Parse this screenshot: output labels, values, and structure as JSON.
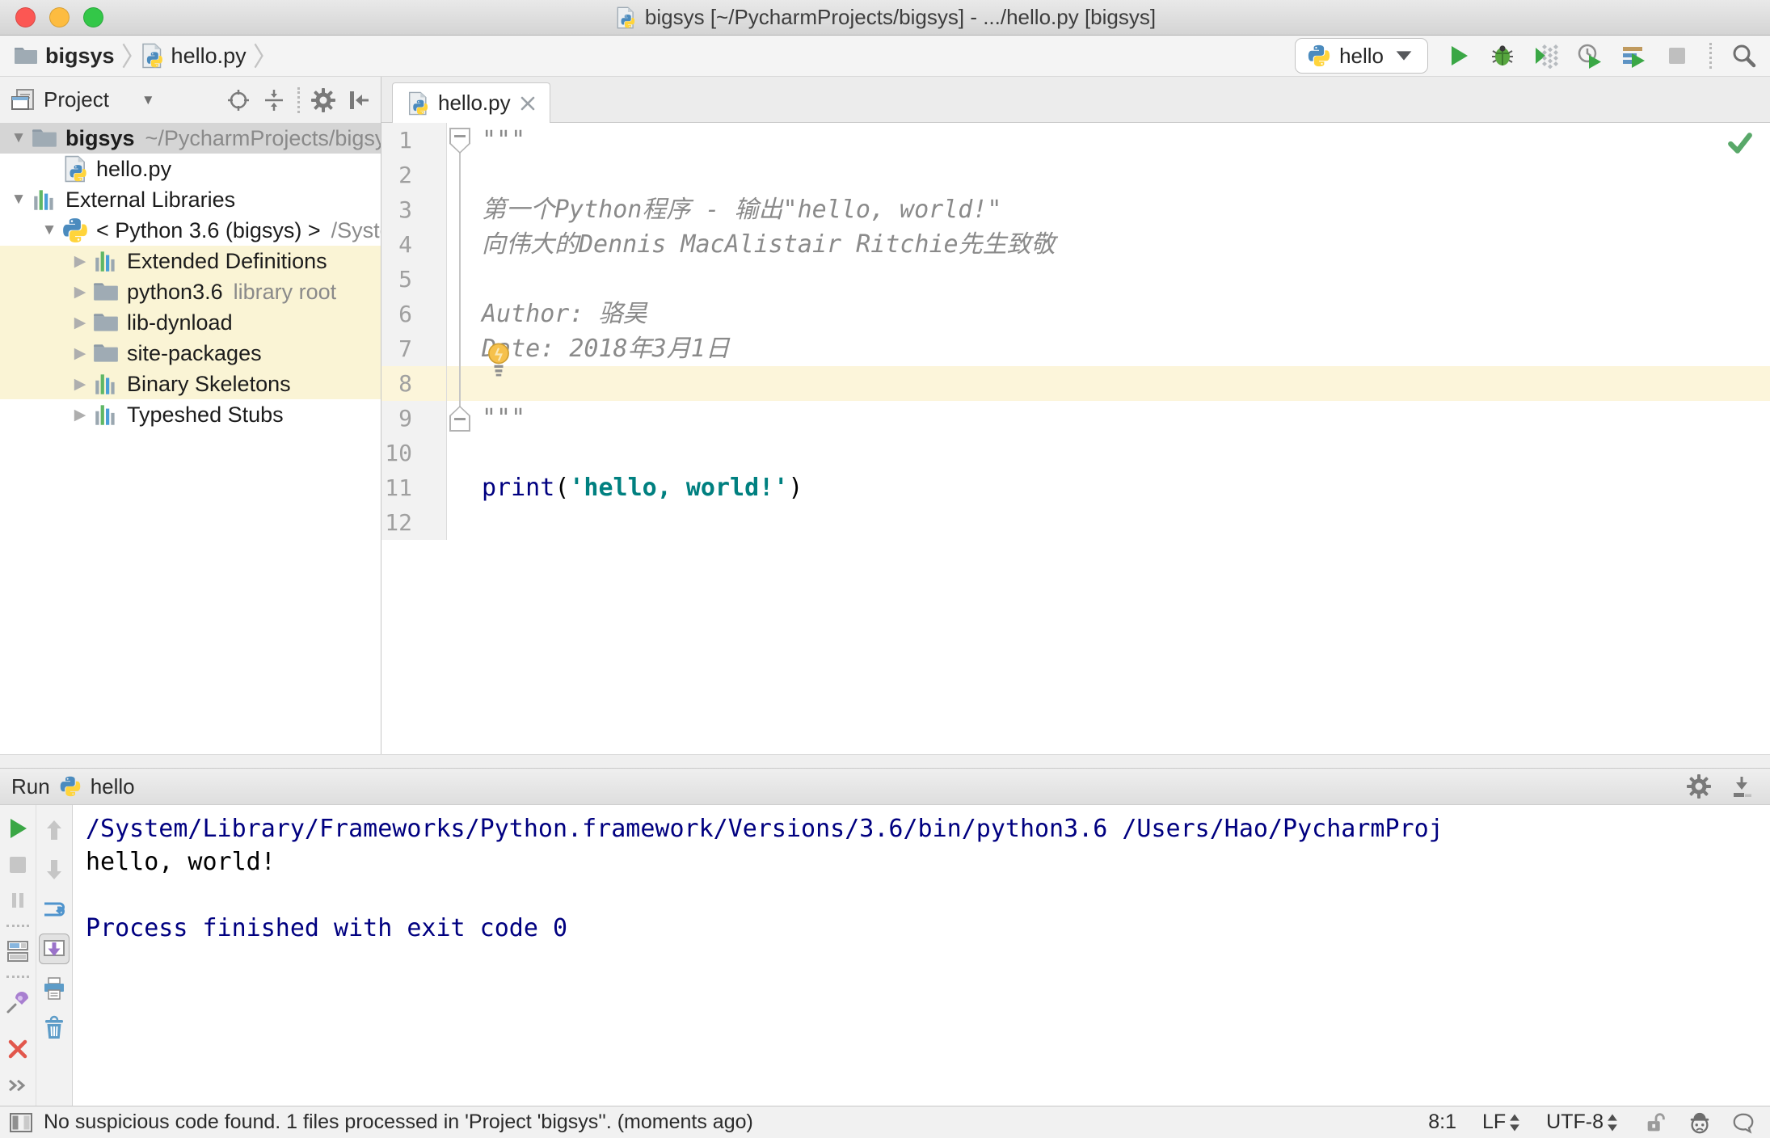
{
  "colors": {
    "comment": "#8a8a8a",
    "keyword": "#000080",
    "string": "#008080",
    "plain": "#000000",
    "console_system": "#000080",
    "console_stdout": "#000000",
    "tree_highlight": "#faf4d5",
    "current_line": "#fcf5da",
    "selection_gray": "#d5d5d5",
    "run_green": "#3aa745",
    "check_green": "#59a869"
  },
  "title_bar": {
    "title": "bigsys [~/PycharmProjects/bigsys] - .../hello.py [bigsys]"
  },
  "nav_bar": {
    "breadcrumbs": [
      {
        "label": "bigsys",
        "icon": "folder",
        "bold": true
      },
      {
        "label": "hello.py",
        "icon": "pyfile",
        "bold": false
      }
    ],
    "run_config": {
      "label": "hello",
      "icon": "python"
    },
    "buttons": [
      {
        "name": "run",
        "icon": "play"
      },
      {
        "name": "debug",
        "icon": "bug"
      },
      {
        "name": "run-with-coverage",
        "icon": "coverage"
      },
      {
        "name": "profiler",
        "icon": "profiler"
      },
      {
        "name": "concurrency-diagram",
        "icon": "concurrency"
      },
      {
        "name": "stop",
        "icon": "stop"
      },
      {
        "name": "separator"
      },
      {
        "name": "search-everywhere",
        "icon": "search"
      }
    ]
  },
  "project_panel": {
    "title": "Project",
    "header_icons": [
      {
        "name": "locate",
        "icon": "target"
      },
      {
        "name": "collapse-all",
        "icon": "collapse"
      },
      {
        "name": "separator"
      },
      {
        "name": "settings",
        "icon": "gear"
      },
      {
        "name": "hide-panel",
        "icon": "hideside"
      }
    ],
    "tree": [
      {
        "label": "bigsys",
        "hint": "~/PycharmProjects/bigsys",
        "icon": "folder",
        "arrow": "expanded",
        "indent": 0,
        "selected": true,
        "bold": true
      },
      {
        "label": "hello.py",
        "icon": "pyfile",
        "arrow": "none",
        "indent": 1
      },
      {
        "label": "External Libraries",
        "icon": "library",
        "arrow": "expanded",
        "indent": 0
      },
      {
        "label": "< Python 3.6 (bigsys) >",
        "hint": "/System",
        "icon": "python",
        "arrow": "expanded",
        "indent": 1
      },
      {
        "label": "Extended Definitions",
        "icon": "library",
        "arrow": "collapsed",
        "indent": 2,
        "highlighted": true
      },
      {
        "label": "python3.6",
        "hint": "library root",
        "icon": "folder",
        "arrow": "collapsed",
        "indent": 2,
        "highlighted": true
      },
      {
        "label": "lib-dynload",
        "icon": "folder",
        "arrow": "collapsed",
        "indent": 2,
        "highlighted": true
      },
      {
        "label": "site-packages",
        "icon": "folder",
        "arrow": "collapsed",
        "indent": 2,
        "highlighted": true
      },
      {
        "label": "Binary Skeletons",
        "icon": "library",
        "arrow": "collapsed",
        "indent": 2,
        "highlighted": true
      },
      {
        "label": "Typeshed Stubs",
        "icon": "library",
        "arrow": "collapsed",
        "indent": 2,
        "highlighted": false
      }
    ]
  },
  "editor": {
    "tab": {
      "label": "hello.py",
      "icon": "pyfile"
    },
    "current_line": 8,
    "lines": [
      {
        "n": 1,
        "segments": [
          {
            "t": "\"\"\"",
            "c": "comment"
          }
        ]
      },
      {
        "n": 2,
        "segments": []
      },
      {
        "n": 3,
        "segments": [
          {
            "t": "第一个Python程序 - 输出\"hello, world!\"",
            "c": "comment"
          }
        ]
      },
      {
        "n": 4,
        "segments": [
          {
            "t": "向伟大的Dennis MacAlistair Ritchie先生致敬",
            "c": "comment"
          }
        ]
      },
      {
        "n": 5,
        "segments": []
      },
      {
        "n": 6,
        "segments": [
          {
            "t": "Author: 骆昊",
            "c": "comment"
          }
        ]
      },
      {
        "n": 7,
        "segments": [
          {
            "t": "Date: 2018年3月1日",
            "c": "comment"
          }
        ]
      },
      {
        "n": 8,
        "segments": []
      },
      {
        "n": 9,
        "segments": [
          {
            "t": "\"\"\"",
            "c": "comment"
          }
        ]
      },
      {
        "n": 10,
        "segments": []
      },
      {
        "n": 11,
        "segments": [
          {
            "t": "print",
            "c": "keyword"
          },
          {
            "t": "(",
            "c": "plain"
          },
          {
            "t": "'hello, world!'",
            "c": "string"
          },
          {
            "t": ")",
            "c": "plain"
          }
        ]
      },
      {
        "n": 12,
        "segments": []
      }
    ]
  },
  "run_panel": {
    "title": "Run",
    "config": {
      "label": "hello",
      "icon": "python"
    },
    "header_icons": [
      {
        "name": "settings",
        "icon": "gear"
      },
      {
        "name": "hide-panel",
        "icon": "hidedown"
      }
    ],
    "toolbar_left": [
      {
        "name": "rerun",
        "icon": "play"
      },
      {
        "name": "stop",
        "icon": "stopgray"
      },
      {
        "name": "pause-output",
        "icon": "pause"
      },
      {
        "name": "separator"
      },
      {
        "name": "restore-layout",
        "icon": "layout"
      },
      {
        "name": "separator"
      },
      {
        "name": "pin-tab",
        "icon": "pin"
      },
      {
        "name": "close",
        "icon": "closered",
        "pushx": true
      },
      {
        "name": "more-options",
        "icon": "more",
        "pushend": true
      }
    ],
    "toolbar_right": [
      {
        "name": "up-the-stack-trace",
        "icon": "up"
      },
      {
        "name": "down-the-stack-trace",
        "icon": "down"
      },
      {
        "name": "use-soft-wraps",
        "icon": "softwrap"
      },
      {
        "name": "scroll-to-the-end",
        "icon": "scrollend",
        "selected": true
      },
      {
        "name": "print",
        "icon": "printer"
      },
      {
        "name": "clear-all",
        "icon": "trash"
      }
    ],
    "console": [
      {
        "text": "/System/Library/Frameworks/Python.framework/Versions/3.6/bin/python3.6 /Users/Hao/PycharmProj",
        "type": "system"
      },
      {
        "text": "hello, world!",
        "type": "stdout"
      },
      {
        "text": "",
        "type": "stdout"
      },
      {
        "text": "Process finished with exit code 0",
        "type": "system"
      }
    ]
  },
  "status_bar": {
    "message": "No suspicious code found. 1 files processed in 'Project 'bigsys''. (moments ago)",
    "caret_position": "8:1",
    "line_separator": "LF",
    "encoding": "UTF-8",
    "icons": [
      {
        "name": "write-access-unlocked",
        "icon": "unlock"
      },
      {
        "name": "hector-inspections",
        "icon": "hector"
      },
      {
        "name": "feedback-bubble",
        "icon": "bubble"
      }
    ]
  }
}
